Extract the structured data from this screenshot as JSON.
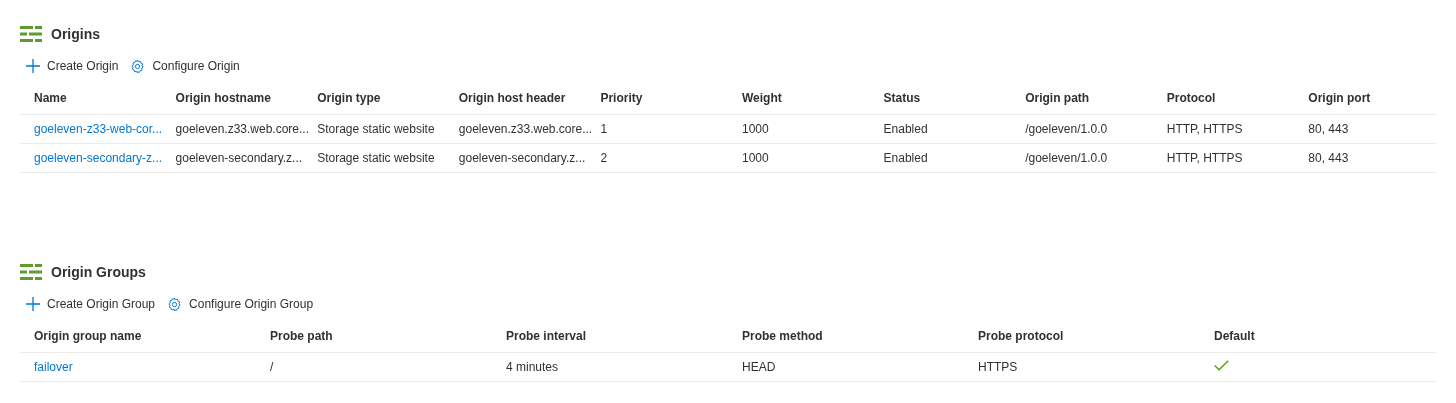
{
  "sections": [
    {
      "title": "Origins",
      "actions": [
        {
          "kind": "create",
          "label": "Create Origin"
        },
        {
          "kind": "configure",
          "label": "Configure Origin"
        }
      ],
      "columns": [
        "Name",
        "Origin hostname",
        "Origin type",
        "Origin host header",
        "Priority",
        "Weight",
        "Status",
        "Origin path",
        "Protocol",
        "Origin port"
      ],
      "rows": [
        {
          "cells": [
            "goeleven-z33-web-cor...",
            "goeleven.z33.web.core...",
            "Storage static website",
            "goeleven.z33.web.core...",
            "1",
            "1000",
            "Enabled",
            "/goeleven/1.0.0",
            "HTTP, HTTPS",
            "80, 443"
          ]
        },
        {
          "cells": [
            "goeleven-secondary-z...",
            "goeleven-secondary.z...",
            "Storage static website",
            "goeleven-secondary.z...",
            "2",
            "1000",
            "Enabled",
            "/goeleven/1.0.0",
            "HTTP, HTTPS",
            "80, 443"
          ]
        }
      ]
    },
    {
      "title": "Origin Groups",
      "actions": [
        {
          "kind": "create",
          "label": "Create Origin Group"
        },
        {
          "kind": "configure",
          "label": "Configure Origin Group"
        }
      ],
      "columns": [
        "Origin group name",
        "Probe path",
        "Probe interval",
        "Probe method",
        "Probe protocol",
        "Default"
      ],
      "rows": [
        {
          "cells": [
            "failover",
            "/",
            "4 minutes",
            "HEAD",
            "HTTPS"
          ],
          "default": true
        }
      ]
    }
  ]
}
